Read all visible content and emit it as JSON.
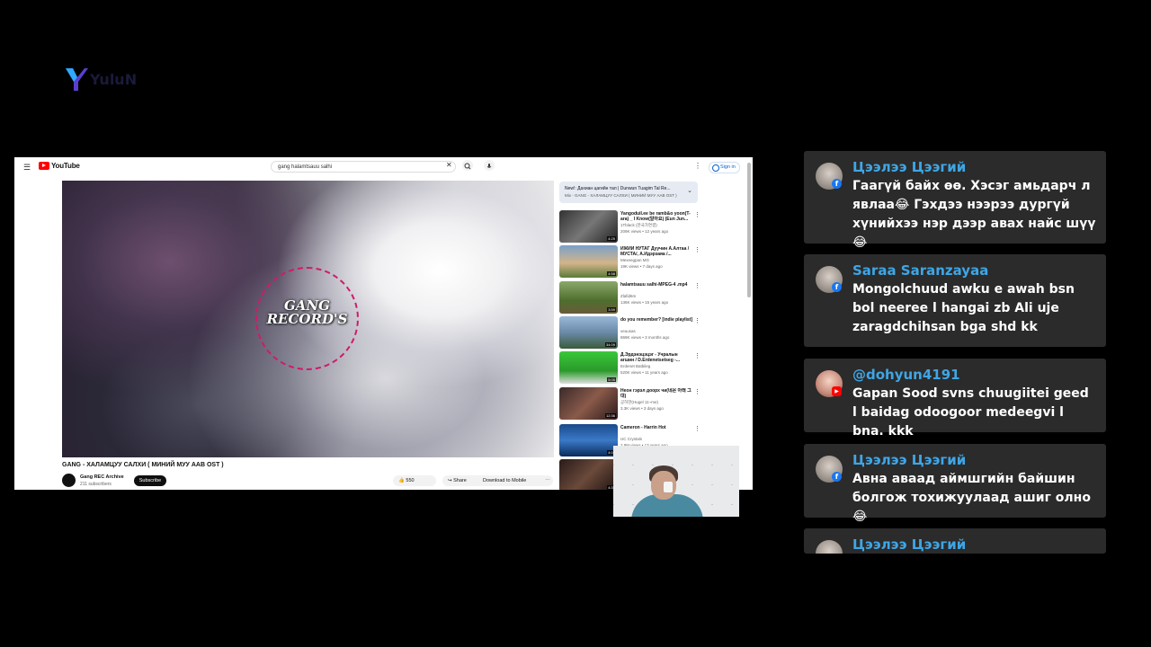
{
  "brand": {
    "logo_icon": "y-brand-icon",
    "logo_text": "YuluN"
  },
  "youtube": {
    "logo_text": "YouTube",
    "search_query": "gang halamtsauu salhi",
    "signin_label": "Sign in",
    "video_title": "GANG - ХАЛАМЦУУ САЛХИ ( МИНИЙ МУУ ААВ OST )",
    "overlay_text": "GANG RECORD'S",
    "channel_name": "Gang REC Archive",
    "channel_subs": "211 subscribers",
    "subscribe_label": "Subscribe",
    "like_count": "550",
    "share_label": "Share",
    "download_label": "Download to Mobile",
    "promo": {
      "line1": "New!: Дахиан цагийн тал | Dunwun Tuagim Tal Re...",
      "line2": "Mix - GANG - ХАЛАМЦУУ САЛХИ ( МИНИЙ МУУ ААВ OST )"
    },
    "recommendations": [
      {
        "title": "Yangoduil.ee be ramb&o yoon(T-ara) _ I Know(알아요) (Eun Jun...",
        "channel": "1Tblack (한국가연결)",
        "meta": "209K views • 12 years ago",
        "duration": "4:25"
      },
      {
        "title": "ИЖИЙ НУТАГ Дуучин А.Алтаа /МУСТА/, А.Идэрзаяа /...",
        "channel": "Mexeegpan MG",
        "meta": "19K views • 7 days ago",
        "duration": "4:58"
      },
      {
        "title": "halamtsauu salhi-MPEG-4 .mp4",
        "channel": "Zlafid6m",
        "meta": "136K views • 15 years ago",
        "duration": "3:59"
      },
      {
        "title": "do you remember? [indie playlist]",
        "channel": "veuusas",
        "meta": "869K views • 3 months ago",
        "duration": "34:09"
      },
      {
        "title": "Д.Эрдэнэцэцэг - Учралын агшин / D.Erdenetsetseg -...",
        "channel": "Erdenet Batbileg",
        "meta": "520K views • 11 years ago",
        "duration": "5:05"
      },
      {
        "title": "Неон гэрэл доорх чи(네온 아래 그대)",
        "channel": "공허한(Hugel 11~me)",
        "meta": "3.3K views • 3 days ago",
        "duration": "12:36"
      },
      {
        "title": "Cameron - Harrin Hot",
        "channel": "UC Crystals",
        "meta": "2.9M views • 13 years ago",
        "duration": "4:03"
      },
      {
        "title": "",
        "channel": "",
        "meta": "",
        "duration": "4:31"
      }
    ]
  },
  "chat": [
    {
      "name": "Цээлээ Цээгий",
      "platform": "facebook",
      "message": "Гаагүй байх өө. Хэсэг амьдарч л явлаа😂 Гэхдээ нээрээ дургүй хүнийхээ нэр дээр авах найс шүү😂"
    },
    {
      "name": "Saraa Saranzayaa",
      "platform": "facebook",
      "message": "Mongolchuud awku e awah bsn bol neeree l hangai zb Ali uje zaragdchihsan bga shd kk"
    },
    {
      "name": "@dohyun4191",
      "platform": "youtube",
      "message": "Gapan Sood svns chuugiitei geed l baidag odoogoor medeegvi l bna. kkk"
    },
    {
      "name": "Цээлээ Цээгий",
      "platform": "facebook",
      "message": "Авна аваад аймшгийн байшин болгож тохижуулаад ашиг олно😂"
    },
    {
      "name": "Цээлээ Цээгий",
      "platform": "facebook",
      "message": ""
    }
  ]
}
